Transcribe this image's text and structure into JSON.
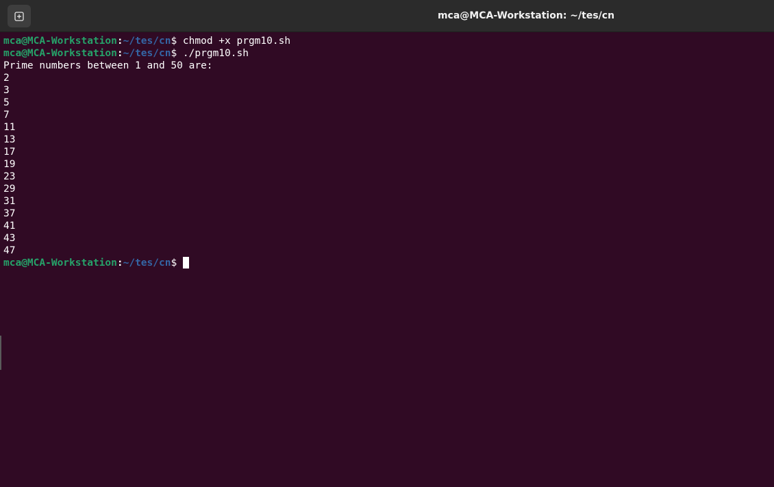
{
  "window": {
    "title": "mca@MCA-Workstation: ~/tes/cn"
  },
  "toolbar": {
    "new_tab_icon": "new-tab-icon"
  },
  "prompt": {
    "user_host": "mca@MCA-Workstation",
    "colon": ":",
    "path": "~/tes/cn",
    "dollar": "$ "
  },
  "session": {
    "commands": [
      "chmod +x prgm10.sh",
      "./prgm10.sh"
    ],
    "output_header": "Prime numbers between 1 and 50 are:",
    "primes": [
      "2",
      "3",
      "5",
      "7",
      "11",
      "13",
      "17",
      "19",
      "23",
      "29",
      "31",
      "37",
      "41",
      "43",
      "47"
    ]
  },
  "colors": {
    "background": "#300a24",
    "titlebar": "#2b2b2b",
    "prompt_user": "#26a269",
    "prompt_path": "#3465a4",
    "text": "#ffffff"
  }
}
